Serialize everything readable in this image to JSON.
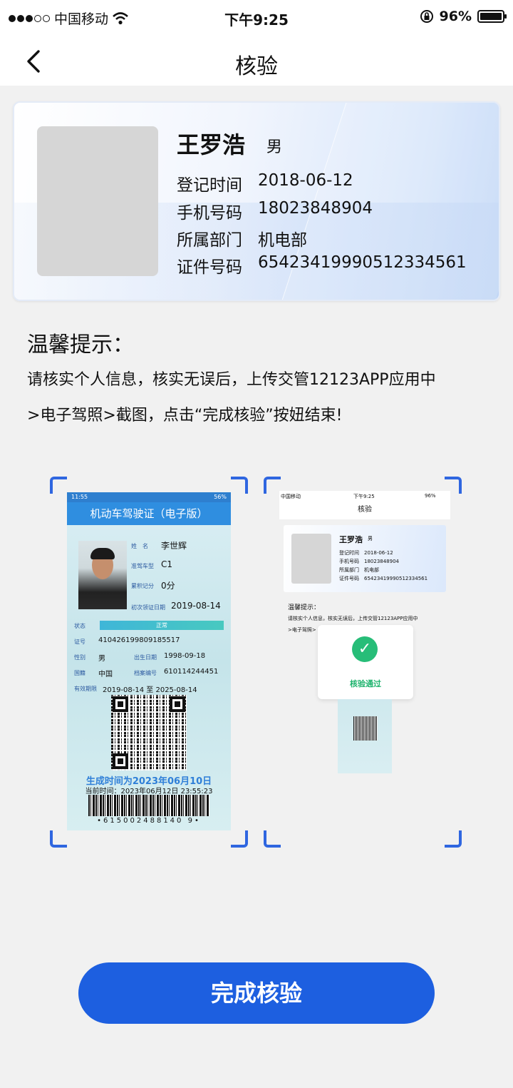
{
  "status_bar": {
    "carrier": "中国移动",
    "time": "下午9:25",
    "battery": "96%"
  },
  "nav": {
    "title": "核验"
  },
  "profile": {
    "name": "王罗浩",
    "gender": "男",
    "fields": [
      {
        "label": "登记时间",
        "value": "2018-06-12"
      },
      {
        "label": "手机号码",
        "value": "18023848904"
      },
      {
        "label": "所属部门",
        "value": "机电部"
      },
      {
        "label": "证件号码",
        "value": "654234199905123345​61"
      }
    ]
  },
  "tips": {
    "title": "温馨提示：",
    "line1": "请核实个人信息，核实无误后，上传交管12123APP应用中",
    "line2": ">电子驾照>截图，点击“完成核验”按妞结束!"
  },
  "license": {
    "time": "11:55",
    "battery": "56%",
    "header": "机动车驾驶证（电子版）",
    "name_label": "姓　名",
    "name": "李世辉",
    "class_label": "准驾车型",
    "class": "C1",
    "points_label": "累积记分",
    "points": "0分",
    "first_label": "初次领证日期",
    "first": "2019-08-14",
    "state_label": "状态",
    "state": "正常",
    "id_label": "证号",
    "id": "410426199809185517",
    "sex_label": "性别",
    "sex": "男",
    "dob_label": "出生日期",
    "dob": "1998-09-18",
    "nation_label": "国籍",
    "nation": "中国",
    "file_label": "档案编号",
    "file": "610114244451",
    "valid_label": "有效期限",
    "valid": "2019-08-14 至 2025-08-14",
    "generated": "生成时间为2023年06月10日",
    "current": "当前时间：2023年06月12日 23:55:23",
    "barcode_number": "•615002488140 9•"
  },
  "example_shot": {
    "carrier": "中国移动",
    "time": "下午9:25",
    "battery": "96%",
    "title": "核验",
    "name": "王罗浩",
    "gender": "男",
    "f1": "登记时间　2018-06-12",
    "f2": "手机号码　18023848904",
    "f3": "所属部门　机电部",
    "f4": "证件号码　65423419990512334561",
    "tip_title": "温馨提示：",
    "tip1": "请核实个人信息，核实无误后，上传交管12123APP应用中",
    "tip2": ">电子驾照>",
    "ok": "核验通过"
  },
  "cta": {
    "label": "完成核验"
  },
  "colors": {
    "accent": "#1d5fe0",
    "frame": "#2f66e0",
    "success": "#27bd78"
  }
}
